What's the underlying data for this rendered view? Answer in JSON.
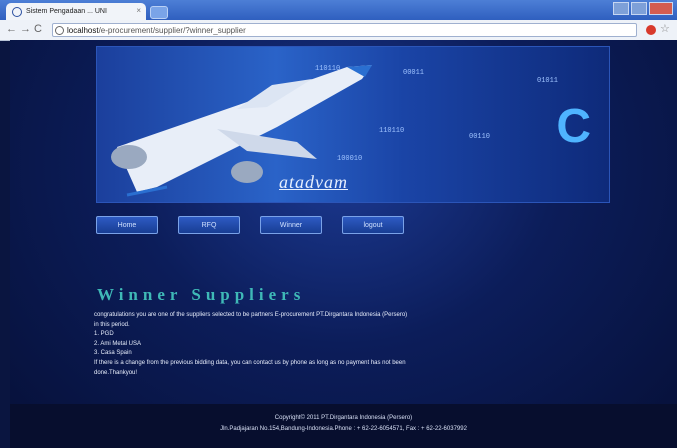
{
  "browser": {
    "tab_title": "Sistem Pengadaan ... UNI",
    "url_host": "localhost",
    "url_path": "/e-procurement/supplier/?winner_supplier"
  },
  "banner": {
    "logo_text": "atadvam",
    "digits": [
      "110110",
      "00011",
      "110110",
      "00110",
      "100010",
      "01011"
    ]
  },
  "nav": {
    "items": [
      "Home",
      "RFQ",
      "Winner",
      "logout"
    ]
  },
  "main": {
    "heading": "Winner Suppliers",
    "intro": "congratulations you are one of the suppliers selected to be partners E-procurement PT.Dirgantara Indonesia (Persero)",
    "period": "in this period.",
    "suppliers": [
      "1. PGD",
      "2. Ami Metal USA",
      "3. Casa Spain"
    ],
    "note_line1": "If there is a change from the previous bidding data, you can contact us by phone as long as no payment has not been",
    "note_line2": "done.Thankyou!"
  },
  "footer": {
    "copyright": "Copyright© 2011 PT.Dirgantara Indonesia (Persero)",
    "address": "Jln.Padjajaran No.154,Bandung-Indonesia.Phone : + 62-22-6054571, Fax : + 62-22-6037992"
  }
}
